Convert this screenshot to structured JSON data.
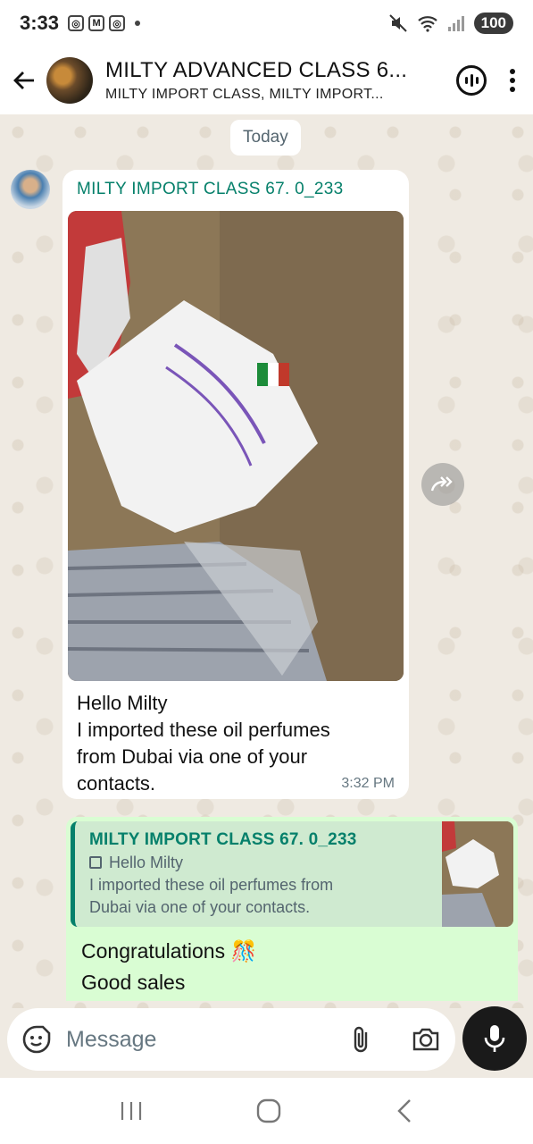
{
  "status_bar": {
    "time": "3:33",
    "battery": "100"
  },
  "header": {
    "title": "MILTY ADVANCED CLASS 6...",
    "subtitle": "MILTY IMPORT CLASS, MILTY IMPORT..."
  },
  "chat": {
    "date_label": "Today",
    "incoming": {
      "sender": "MILTY IMPORT CLASS 67. 0_233",
      "lines": [
        "Hello Milty",
        "I imported these oil perfumes",
        "from Dubai via one of your",
        "contacts."
      ],
      "time": "3:32 PM"
    },
    "outgoing": {
      "quote_sender": "MILTY IMPORT CLASS 67. 0_233",
      "quote_line1": "Hello Milty",
      "quote_line2": "I imported these oil perfumes from",
      "quote_line3": "Dubai via one of your contacts.",
      "line1": "Congratulations 🎊",
      "line2": "Good sales"
    }
  },
  "input": {
    "placeholder": "Message"
  },
  "icons": [
    "back-arrow-icon",
    "voice-chat-icon",
    "more-options-icon",
    "forward-icon",
    "sticker-icon",
    "attach-icon",
    "camera-icon",
    "mic-icon",
    "recents-icon",
    "home-icon",
    "back-nav-icon"
  ]
}
